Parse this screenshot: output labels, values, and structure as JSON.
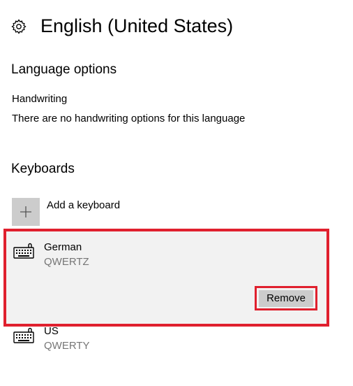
{
  "header": {
    "title": "English (United States)",
    "icon": "gear-icon"
  },
  "language_options": {
    "heading": "Language options",
    "handwriting_label": "Handwriting",
    "handwriting_note": "There are no handwriting options for this language"
  },
  "keyboards": {
    "heading": "Keyboards",
    "add_label": "Add a keyboard",
    "items": [
      {
        "name": "German",
        "layout": "QWERTZ",
        "icon": "keyboard-icon",
        "selected": true,
        "action_label": "Remove"
      },
      {
        "name": "US",
        "layout": "QWERTY",
        "icon": "keyboard-icon",
        "selected": false
      }
    ]
  },
  "colors": {
    "highlight": "#e0202e",
    "selected_bg": "#f2f2f2",
    "button_bg": "#cccccc",
    "secondary_text": "#767676"
  }
}
